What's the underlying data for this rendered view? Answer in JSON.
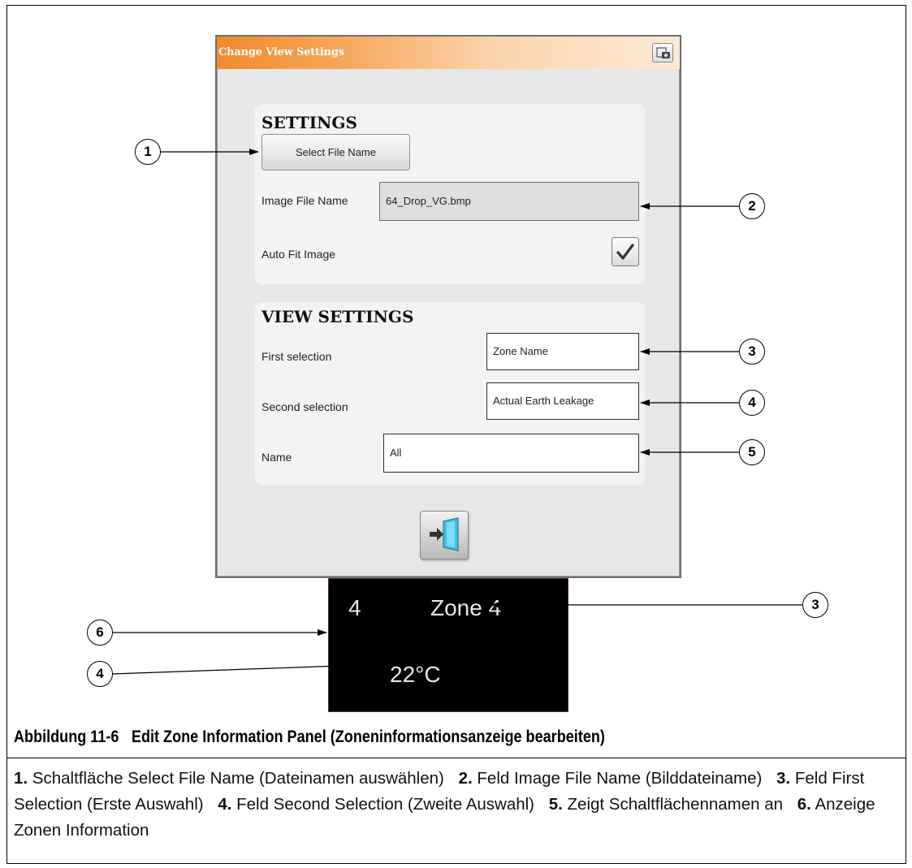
{
  "dialog": {
    "title": "Change View Settings",
    "title_icon": "screen-camera-icon",
    "settings_group": {
      "heading": "SETTINGS",
      "select_file_button": "Select File Name",
      "image_file_label": "Image File Name",
      "image_file_value": "64_Drop_VG.bmp",
      "auto_fit_label": "Auto Fit Image",
      "auto_fit_checked": true
    },
    "view_settings_group": {
      "heading": "VIEW SETTINGS",
      "first_selection_label": "First selection",
      "first_selection_value": "Zone Name",
      "second_selection_label": "Second selection",
      "second_selection_value": "Actual Earth Leakage",
      "name_label": "Name",
      "name_value": "All"
    },
    "exit_button_icon": "exit-door-icon"
  },
  "zone_panel": {
    "number": "4",
    "name": "Zone 4",
    "temperature": "22°C"
  },
  "callouts": [
    "1",
    "2",
    "3",
    "4",
    "5",
    "3",
    "6",
    "4"
  ],
  "caption": {
    "figure_number": "Abbildung 11-6",
    "figure_title": "Edit Zone Information Panel (Zoneninformationsanzeige bearbeiten)",
    "items": [
      {
        "num": "1.",
        "text": "Schaltfläche Select File Name (Dateinamen auswählen)"
      },
      {
        "num": "2.",
        "text": "Feld Image File Name (Bilddateiname)"
      },
      {
        "num": "3.",
        "text": "Feld First Selection (Erste Auswahl)"
      },
      {
        "num": "4.",
        "text": "Feld Second Selection (Zweite Auswahl)"
      },
      {
        "num": "5.",
        "text": "Zeigt Schaltflächennamen an"
      },
      {
        "num": "6.",
        "text": "Anzeige Zonen Information"
      }
    ]
  }
}
